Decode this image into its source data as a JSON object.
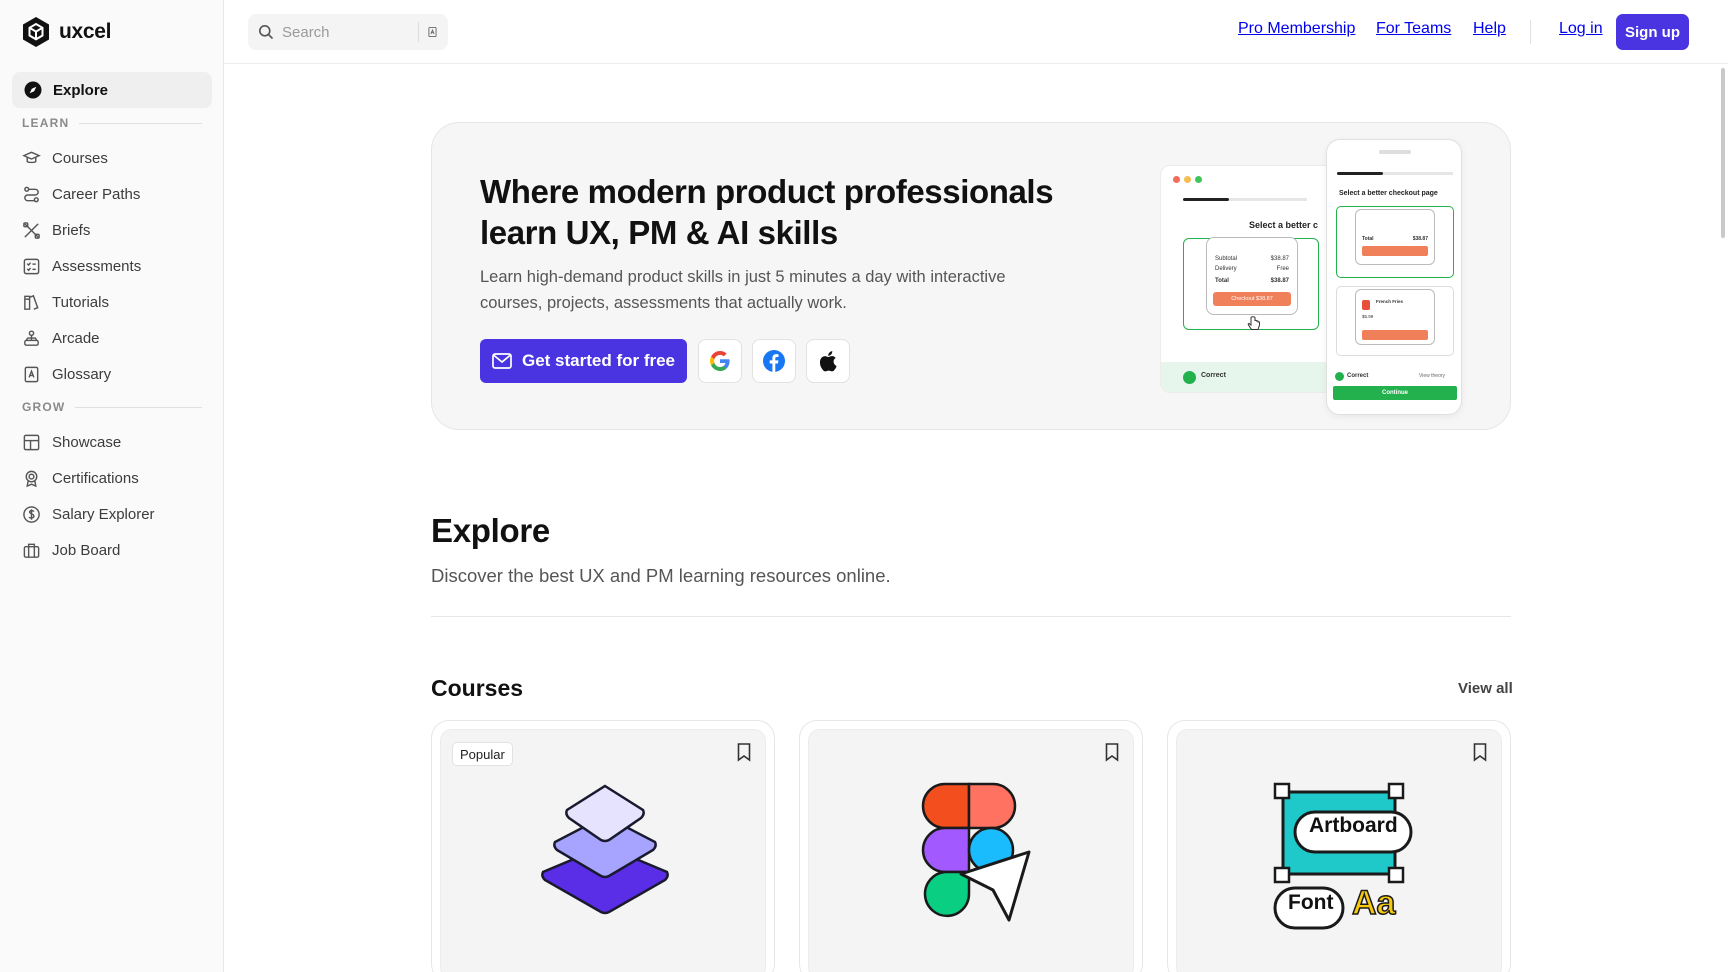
{
  "brand": {
    "name": "uxcel"
  },
  "sidebar": {
    "explore_label": "Explore",
    "learn_header": "LEARN",
    "learn_items": [
      {
        "label": "Courses",
        "icon": "graduation-cap-icon"
      },
      {
        "label": "Career Paths",
        "icon": "route-icon"
      },
      {
        "label": "Briefs",
        "icon": "tools-icon"
      },
      {
        "label": "Assessments",
        "icon": "checklist-icon"
      },
      {
        "label": "Tutorials",
        "icon": "book-icon"
      },
      {
        "label": "Arcade",
        "icon": "joystick-icon"
      },
      {
        "label": "Glossary",
        "icon": "dictionary-icon"
      }
    ],
    "grow_header": "GROW",
    "grow_items": [
      {
        "label": "Showcase",
        "icon": "layout-icon"
      },
      {
        "label": "Certifications",
        "icon": "award-icon"
      },
      {
        "label": "Salary Explorer",
        "icon": "dollar-icon"
      },
      {
        "label": "Job Board",
        "icon": "briefcase-icon"
      }
    ]
  },
  "topbar": {
    "search_placeholder": "Search",
    "nav": [
      "Pro Membership",
      "For Teams",
      "Help"
    ],
    "login_label": "Log in",
    "signup_label": "Sign up"
  },
  "hero": {
    "title": "Where modern product professionals learn UX, PM & AI skills",
    "subtitle": "Learn high-demand product skills in just 5 minutes a day with interactive courses, projects, assessments that actually work.",
    "cta_label": "Get started for free",
    "illustration": {
      "desk_question": "Select a better c",
      "phone_question": "Select a better checkout page",
      "correct_label": "Correct",
      "view_theory": "View theory",
      "continue_label": "Continue",
      "checkout_label": "Checkout $38.87",
      "total_label": "Total",
      "total_value": "$38.87",
      "subtotal_label": "Subtotal",
      "subtotal_value": "$38.87",
      "delivery_label": "Delivery",
      "delivery_value": "Free",
      "item_name": "French Fries",
      "item_price": "$5.99"
    }
  },
  "explore": {
    "title": "Explore",
    "description": "Discover the best UX and PM learning resources online."
  },
  "courses": {
    "title": "Courses",
    "view_all": "View all",
    "cards": [
      {
        "badge": "Popular"
      },
      {
        "badge": ""
      },
      {
        "badge": "",
        "artboard_label": "Artboard",
        "font_label": "Font",
        "aa_label": "Aa"
      }
    ]
  },
  "colors": {
    "brand_primary": "#4a33e0",
    "success_green": "#22b14c",
    "checkout_orange": "#f0805a"
  }
}
